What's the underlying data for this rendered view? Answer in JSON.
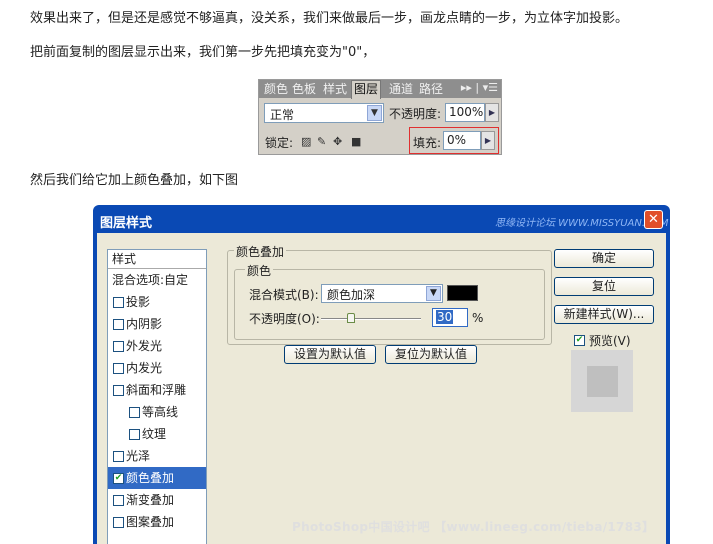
{
  "article": {
    "p1": "效果出来了，但是还是感觉不够逼真，没关系，我们来做最后一步，画龙点睛的一步，为立体字加投影。",
    "p2": "把前面复制的图层显示出来，我们第一步先把填充变为\"0\"，",
    "p3": "然后我们给它加上颜色叠加，如下图"
  },
  "layers_panel": {
    "tabs": [
      "颜色",
      "色板",
      "样式",
      "图层",
      "通道",
      "路径"
    ],
    "active_tab": "图层",
    "blend_mode": "正常",
    "opacity_label": "不透明度:",
    "opacity_value": "100%",
    "lock_label": "锁定:",
    "fill_label": "填充:",
    "fill_value": "0%"
  },
  "dialog": {
    "title": "图层样式",
    "watermark_top": "思缘设计论坛 WWW.MISSYUAN.COM",
    "close_icon": "close-icon",
    "style_list": {
      "header": "样式",
      "items": [
        {
          "label": "混合选项:自定",
          "checkbox": false,
          "checked": false,
          "indent": 0
        },
        {
          "label": "投影",
          "checkbox": true,
          "checked": false,
          "indent": 0
        },
        {
          "label": "内阴影",
          "checkbox": true,
          "checked": false,
          "indent": 0
        },
        {
          "label": "外发光",
          "checkbox": true,
          "checked": false,
          "indent": 0
        },
        {
          "label": "内发光",
          "checkbox": true,
          "checked": false,
          "indent": 0
        },
        {
          "label": "斜面和浮雕",
          "checkbox": true,
          "checked": false,
          "indent": 0
        },
        {
          "label": "等高线",
          "checkbox": true,
          "checked": false,
          "indent": 1
        },
        {
          "label": "纹理",
          "checkbox": true,
          "checked": false,
          "indent": 1
        },
        {
          "label": "光泽",
          "checkbox": true,
          "checked": false,
          "indent": 0
        },
        {
          "label": "颜色叠加",
          "checkbox": true,
          "checked": true,
          "indent": 0,
          "selected": true
        },
        {
          "label": "渐变叠加",
          "checkbox": true,
          "checked": false,
          "indent": 0
        },
        {
          "label": "图案叠加",
          "checkbox": true,
          "checked": false,
          "indent": 0
        }
      ]
    },
    "section_title": "颜色叠加",
    "group_title": "颜色",
    "blend_mode_label": "混合模式(B):",
    "blend_mode_value": "颜色加深",
    "overlay_color": "#000000",
    "opacity_label": "不透明度(O):",
    "opacity_value": "30",
    "opacity_unit": "%",
    "opacity_percent": 30,
    "set_default": "设置为默认值",
    "reset_default": "复位为默认值",
    "ok": "确定",
    "reset": "复位",
    "new_style": "新建样式(W)...",
    "preview_label": "预览(V)",
    "preview_checked": true,
    "watermark_bottom": "PhotoShop中国设计吧 【www.lineeg.com/tieba/1783】"
  }
}
